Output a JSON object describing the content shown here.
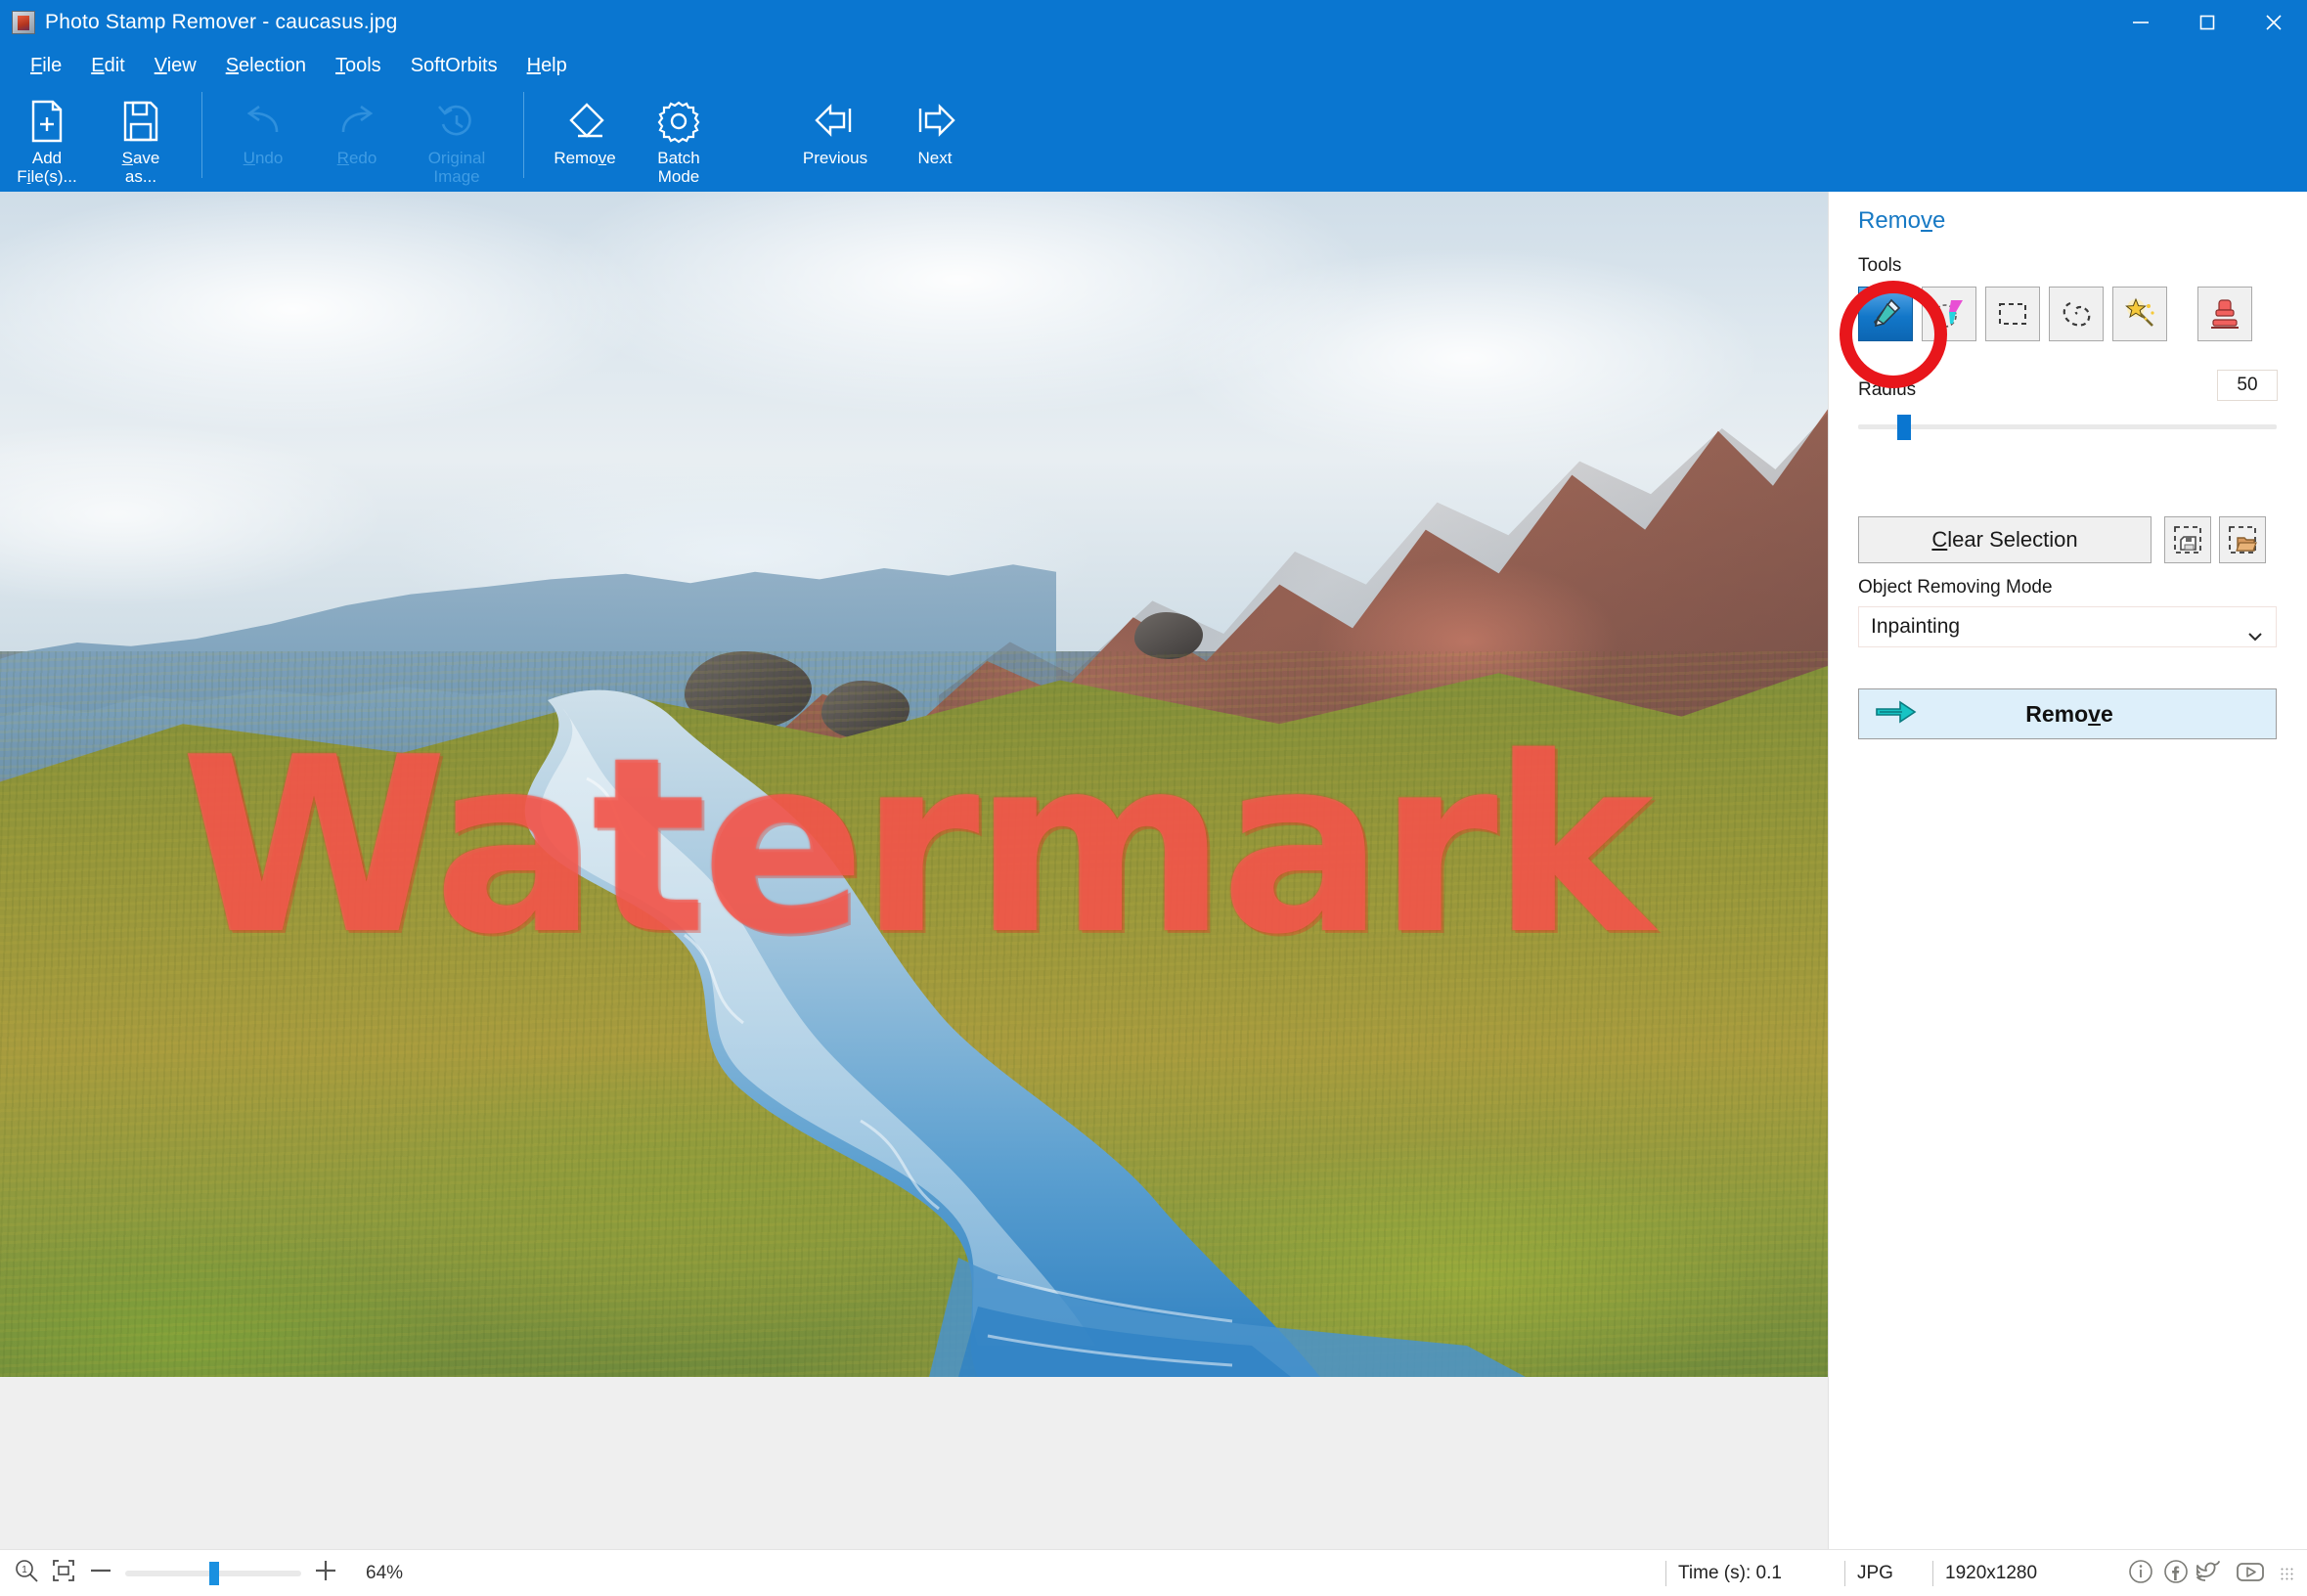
{
  "window": {
    "title": "Photo Stamp Remover - caucasus.jpg",
    "app_icon": "photo-stamp-remover-icon",
    "minimize_label": "Minimize",
    "maximize_label": "Maximize",
    "close_label": "Close",
    "accent_color": "#0a76d0"
  },
  "menubar": {
    "items": [
      {
        "label": "File",
        "mnemonic": "F"
      },
      {
        "label": "Edit",
        "mnemonic": "E"
      },
      {
        "label": "View",
        "mnemonic": "V"
      },
      {
        "label": "Selection",
        "mnemonic": "S"
      },
      {
        "label": "Tools",
        "mnemonic": "T"
      },
      {
        "label": "SoftOrbits",
        "mnemonic": ""
      },
      {
        "label": "Help",
        "mnemonic": "H"
      }
    ]
  },
  "ribbon": {
    "buttons": [
      {
        "label": "Add\nFile(s)...",
        "icon": "add-file-icon",
        "enabled": true
      },
      {
        "label": "Save\nas...",
        "icon": "save-as-icon",
        "enabled": true
      },
      {
        "label": "Undo",
        "icon": "undo-icon",
        "enabled": false
      },
      {
        "label": "Redo",
        "icon": "redo-icon",
        "enabled": false
      },
      {
        "label": "Original\nImage",
        "icon": "original-image-icon",
        "enabled": false
      },
      {
        "label": "Remove",
        "icon": "eraser-icon",
        "enabled": true
      },
      {
        "label": "Batch\nMode",
        "icon": "gear-icon",
        "enabled": true
      },
      {
        "label": "Previous",
        "icon": "previous-arrow-icon",
        "enabled": true
      },
      {
        "label": "Next",
        "icon": "next-arrow-icon",
        "enabled": true
      }
    ]
  },
  "canvas": {
    "watermark_text": "Watermark",
    "image_name": "caucasus.jpg"
  },
  "panel": {
    "title": "Remove",
    "title_mnemonic": "v",
    "tools_label": "Tools",
    "tools": [
      {
        "name": "marker-tool",
        "label": "Marker",
        "selected": true
      },
      {
        "name": "highlighter-tool",
        "label": "Highlighter",
        "selected": false
      },
      {
        "name": "rectangle-select-tool",
        "label": "Rectangle Selection",
        "selected": false
      },
      {
        "name": "lasso-select-tool",
        "label": "Lasso Selection",
        "selected": false
      },
      {
        "name": "magic-wand-tool",
        "label": "Magic Wand",
        "selected": false
      },
      {
        "name": "clone-stamp-tool",
        "label": "Clone Stamp",
        "selected": false
      }
    ],
    "radius_label": "Radius",
    "radius_value": "50",
    "radius_slider_percent": 10,
    "clear_selection_label": "Clear Selection",
    "clear_selection_mnemonic": "C",
    "save_selection_icon": "save-selection-icon",
    "load_selection_icon": "load-selection-icon",
    "object_removing_mode_label": "Object Removing Mode",
    "object_removing_mode_value": "Inpainting",
    "remove_button_label": "Remove",
    "remove_button_mnemonic": "v",
    "remove_button_icon": "green-arrow-icon"
  },
  "statusbar": {
    "zoom_icon": "zoom-one-to-one-icon",
    "fit_icon": "fit-to-window-icon",
    "minus_label": "−",
    "plus_label": "+",
    "zoom_percent": "64%",
    "zoom_slider_percent": 48,
    "time_label": "Time (s): 0.1",
    "format_label": "JPG",
    "dimensions_label": "1920x1280",
    "social": [
      {
        "name": "info-icon"
      },
      {
        "name": "facebook-icon"
      },
      {
        "name": "twitter-icon"
      },
      {
        "name": "youtube-icon"
      }
    ]
  },
  "annotation": {
    "shape": "circle",
    "color": "#e8161b",
    "target": "marker-tool"
  }
}
